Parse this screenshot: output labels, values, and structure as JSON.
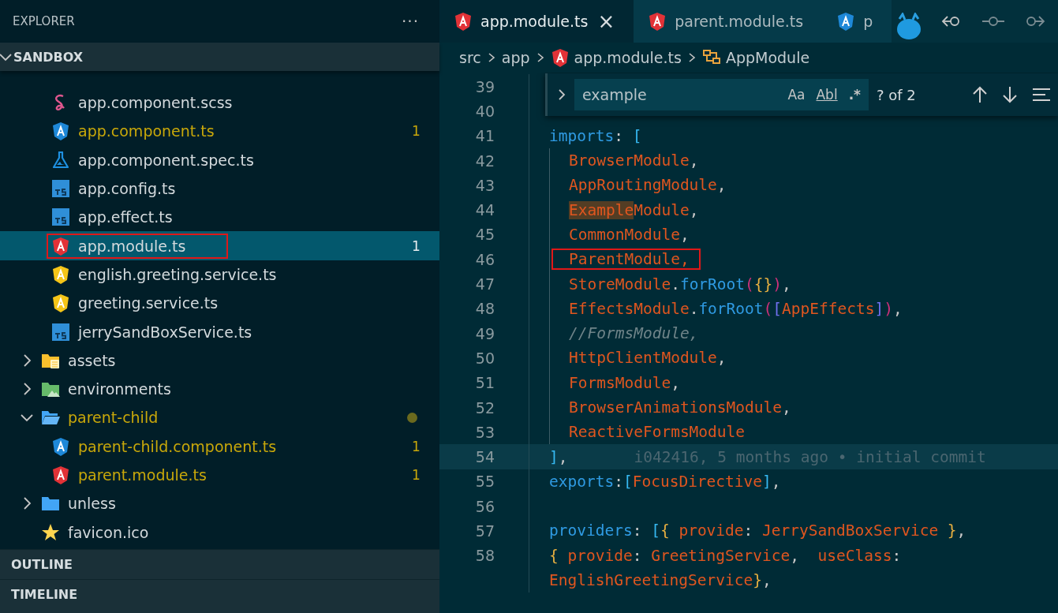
{
  "sidebar": {
    "title": "EXPLORER",
    "more": "···",
    "section": {
      "label": "SANDBOX",
      "expanded": true
    },
    "tree": [
      {
        "children": [
          {
            "label": "app.component.scss",
            "kind": "sass",
            "modified": false,
            "selected": false,
            "highlighted": false
          },
          {
            "label": "app.component.ts",
            "kind": "angular-blue",
            "modified": true,
            "badge": "1",
            "selected": false,
            "highlighted": false
          },
          {
            "label": "app.component.spec.ts",
            "kind": "test",
            "modified": false,
            "selected": false,
            "highlighted": false
          },
          {
            "label": "app.config.ts",
            "kind": "ts",
            "modified": false,
            "selected": false,
            "highlighted": false
          },
          {
            "label": "app.effect.ts",
            "kind": "ts",
            "modified": false,
            "selected": false,
            "highlighted": false
          },
          {
            "label": "app.module.ts",
            "kind": "angular-red",
            "modified": false,
            "badge": "1",
            "selected": true,
            "highlighted": true
          },
          {
            "label": "english.greeting.service.ts",
            "kind": "angular-yellow",
            "modified": false,
            "selected": false,
            "highlighted": false
          },
          {
            "label": "greeting.service.ts",
            "kind": "angular-yellow",
            "modified": false,
            "selected": false,
            "highlighted": false
          },
          {
            "label": "jerrySandBoxService.ts",
            "kind": "ts",
            "modified": false,
            "selected": false,
            "highlighted": false
          }
        ]
      },
      {
        "label": "assets",
        "kind": "folder-assets",
        "modified": false,
        "expanded": false,
        "selected": false,
        "highlighted": false
      },
      {
        "label": "environments",
        "kind": "folder-env",
        "modified": false,
        "expanded": false,
        "selected": false,
        "highlighted": false
      },
      {
        "label": "parent-child",
        "kind": "folder-open",
        "modified": true,
        "dot": true,
        "expanded": true,
        "selected": false,
        "highlighted": false,
        "children": [
          {
            "label": "parent-child.component.ts",
            "kind": "angular-blue",
            "modified": true,
            "badge": "1",
            "selected": false,
            "highlighted": false
          },
          {
            "label": "parent.module.ts",
            "kind": "angular-red",
            "modified": true,
            "badge": "1",
            "selected": false,
            "highlighted": false
          }
        ]
      },
      {
        "label": "unless",
        "kind": "folder",
        "modified": false,
        "expanded": false,
        "selected": false,
        "highlighted": false
      },
      {
        "label": "favicon.ico",
        "kind": "star",
        "modified": false,
        "selected": false,
        "highlighted": false
      }
    ],
    "panels": [
      {
        "label": "OUTLINE"
      },
      {
        "label": "TIMELINE"
      }
    ]
  },
  "tabs": [
    {
      "label": "app.module.ts",
      "kind": "angular-red",
      "selected": true,
      "close": "×"
    },
    {
      "label": "parent.module.ts",
      "kind": "angular-red",
      "selected": false
    },
    {
      "label": "p",
      "kind": "angular-blue",
      "selected": false
    }
  ],
  "breadcrumb": [
    {
      "label": "src",
      "kind": "folder"
    },
    {
      "label": "app",
      "kind": "folder"
    },
    {
      "label": "app.module.ts",
      "kind": "angular-red"
    },
    {
      "label": "AppModule",
      "kind": "module"
    }
  ],
  "find": {
    "value": "example",
    "options": [
      "Aa",
      "Abl",
      ".*"
    ],
    "result": "? of 2"
  },
  "code": [
    {
      "number": "39",
      "current": false
    },
    {
      "number": "40",
      "current": false
    },
    {
      "number": "41",
      "current": false,
      "tokens": [
        {
          "kind": "prop",
          "text": "imports"
        },
        {
          "kind": "punct",
          "text": ": "
        },
        {
          "kind": "bracket1",
          "text": "["
        }
      ]
    },
    {
      "number": "42",
      "current": false,
      "indented": true,
      "tokens": [
        {
          "kind": "type",
          "text": "BrowserModule"
        },
        {
          "kind": "punct",
          "text": ","
        }
      ]
    },
    {
      "number": "43",
      "current": false,
      "indented": true,
      "tokens": [
        {
          "kind": "type",
          "text": "AppRoutingModule"
        },
        {
          "kind": "punct",
          "text": ","
        }
      ]
    },
    {
      "number": "44",
      "current": false,
      "indented": true,
      "tokens": [
        {
          "kind": "match",
          "text": "Example"
        },
        {
          "kind": "type",
          "text": "Module"
        },
        {
          "kind": "punct",
          "text": ","
        }
      ]
    },
    {
      "number": "45",
      "current": false,
      "indented": true,
      "tokens": [
        {
          "kind": "type",
          "text": "CommonModule"
        },
        {
          "kind": "punct",
          "text": ","
        }
      ]
    },
    {
      "number": "46",
      "current": false,
      "indented": true,
      "tokens": [
        {
          "kind": "boxed",
          "text": "ParentModule,"
        }
      ]
    },
    {
      "number": "47",
      "current": false,
      "indented": true,
      "tokens": [
        {
          "kind": "type",
          "text": "StoreModule"
        },
        {
          "kind": "punct",
          "text": "."
        },
        {
          "kind": "prop",
          "text": "forRoot"
        },
        {
          "kind": "bracket2",
          "text": "("
        },
        {
          "kind": "bracket3",
          "text": "{}"
        },
        {
          "kind": "bracket2",
          "text": ")"
        },
        {
          "kind": "punct",
          "text": ","
        }
      ]
    },
    {
      "number": "48",
      "current": false,
      "indented": true,
      "tokens": [
        {
          "kind": "type",
          "text": "EffectsModule"
        },
        {
          "kind": "punct",
          "text": "."
        },
        {
          "kind": "prop",
          "text": "forRoot"
        },
        {
          "kind": "bracket2",
          "text": "("
        },
        {
          "kind": "bracket4",
          "text": "["
        },
        {
          "kind": "type",
          "text": "AppEffects"
        },
        {
          "kind": "bracket4",
          "text": "]"
        },
        {
          "kind": "bracket2",
          "text": ")"
        },
        {
          "kind": "punct",
          "text": ","
        }
      ]
    },
    {
      "number": "49",
      "current": false,
      "indented": true,
      "tokens": [
        {
          "kind": "comment",
          "text": "//FormsModule,"
        }
      ]
    },
    {
      "number": "50",
      "current": false,
      "indented": true,
      "tokens": [
        {
          "kind": "type",
          "text": "HttpClientModule"
        },
        {
          "kind": "punct",
          "text": ","
        }
      ]
    },
    {
      "number": "51",
      "current": false,
      "indented": true,
      "tokens": [
        {
          "kind": "type",
          "text": "FormsModule"
        },
        {
          "kind": "punct",
          "text": ","
        }
      ]
    },
    {
      "number": "52",
      "current": false,
      "indented": true,
      "tokens": [
        {
          "kind": "type",
          "text": "BrowserAnimationsModule"
        },
        {
          "kind": "punct",
          "text": ","
        }
      ]
    },
    {
      "number": "53",
      "current": false,
      "indented": true,
      "tokens": [
        {
          "kind": "type",
          "text": "ReactiveFormsModule"
        }
      ]
    },
    {
      "number": "54",
      "current": true,
      "tokens": [
        {
          "kind": "bracket1",
          "text": "]"
        },
        {
          "kind": "punct",
          "text": ","
        },
        {
          "kind": "blame",
          "text": "i042416, 5 months ago • initial commit"
        }
      ]
    },
    {
      "number": "55",
      "current": false,
      "tokens": [
        {
          "kind": "prop",
          "text": "exports"
        },
        {
          "kind": "punct",
          "text": ":"
        },
        {
          "kind": "bracket1",
          "text": "["
        },
        {
          "kind": "type",
          "text": "FocusDirective"
        },
        {
          "kind": "bracket1",
          "text": "]"
        },
        {
          "kind": "punct",
          "text": ","
        }
      ]
    },
    {
      "number": "56",
      "current": false
    },
    {
      "number": "57",
      "current": false,
      "tokens": [
        {
          "kind": "prop",
          "text": "providers"
        },
        {
          "kind": "punct",
          "text": ": "
        },
        {
          "kind": "bracket1",
          "text": "["
        },
        {
          "kind": "bracket3",
          "text": "{"
        },
        {
          "kind": "type",
          "text": " provide"
        },
        {
          "kind": "punct",
          "text": ": "
        },
        {
          "kind": "type",
          "text": "JerrySandBoxService"
        },
        {
          "kind": "bracket3",
          "text": " }"
        },
        {
          "kind": "punct",
          "text": ","
        }
      ]
    },
    {
      "number": "58",
      "current": false,
      "tokens": [
        {
          "kind": "bracket3",
          "text": "{"
        },
        {
          "kind": "type",
          "text": " provide"
        },
        {
          "kind": "punct",
          "text": ": "
        },
        {
          "kind": "type",
          "text": "GreetingService"
        },
        {
          "kind": "punct",
          "text": ",  "
        },
        {
          "kind": "type",
          "text": "useClass"
        },
        {
          "kind": "punct",
          "text": ":"
        }
      ]
    },
    {
      "current": false,
      "tokens": [
        {
          "kind": "type",
          "text": "EnglishGreetingService"
        },
        {
          "kind": "bracket3",
          "text": "}"
        },
        {
          "kind": "punct",
          "text": ","
        }
      ]
    }
  ]
}
